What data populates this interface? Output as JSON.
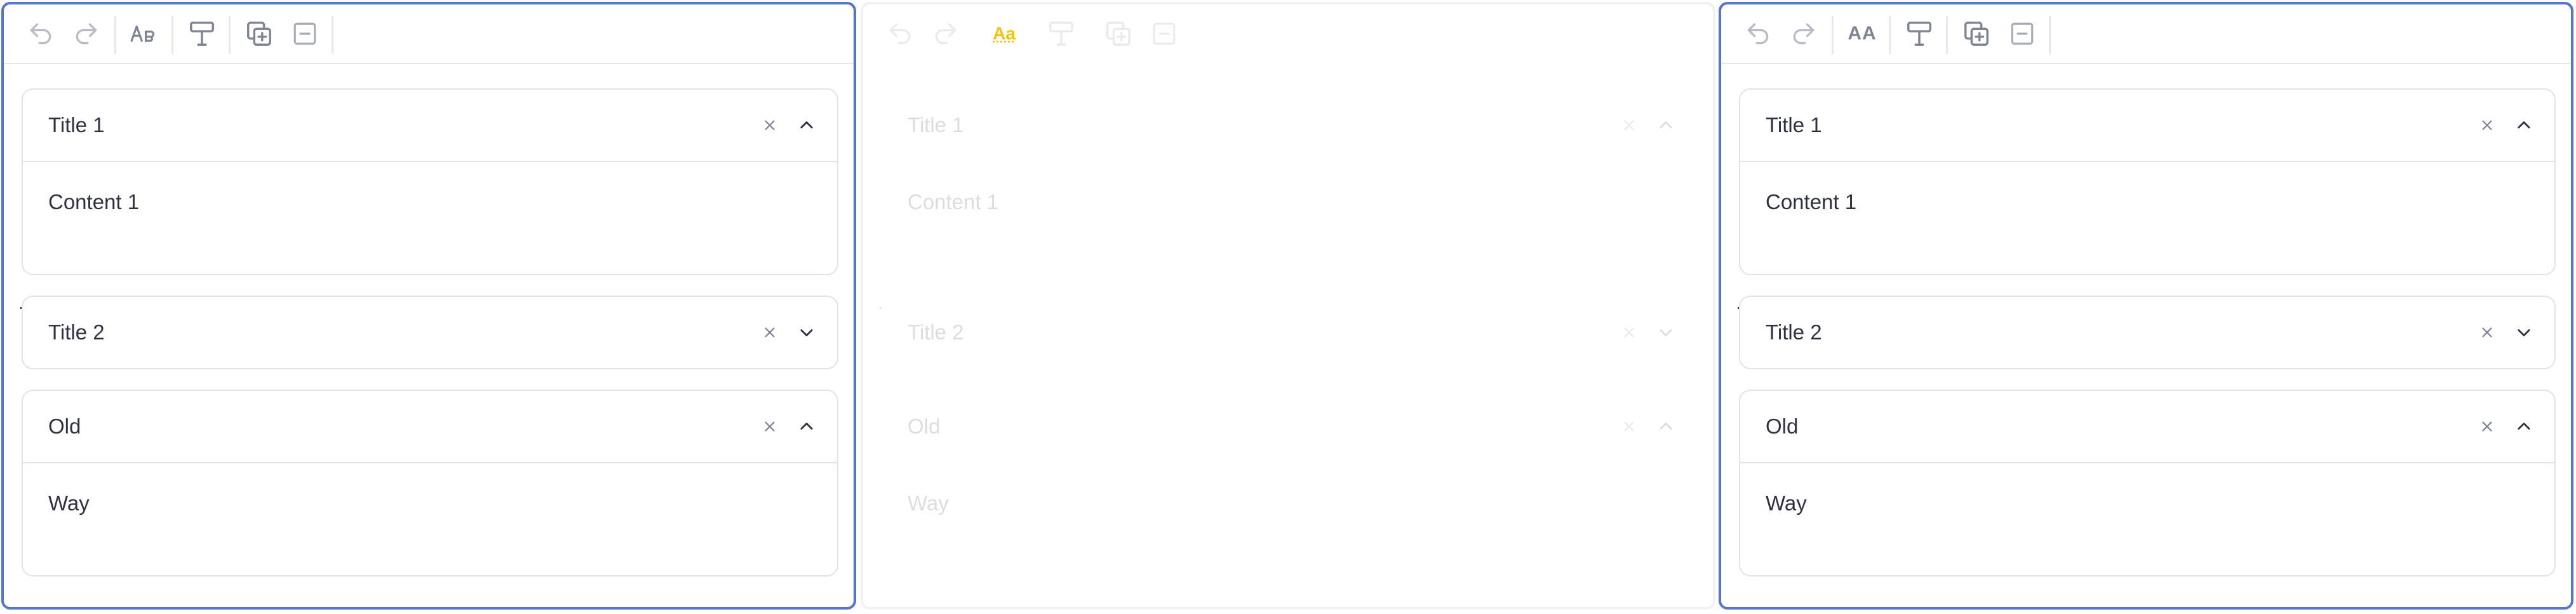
{
  "panels": [
    {
      "id": "left",
      "state": "selected",
      "toolbar": {
        "buttons": [
          "undo-icon",
          "redo-icon",
          "text-size-icon",
          "text-format-icon",
          "add-section-icon",
          "remove-section-icon"
        ]
      },
      "sections": [
        {
          "title": "Title 1",
          "content": "Content 1",
          "expanded": true
        },
        {
          "title": "Title 2",
          "content": "",
          "expanded": false
        },
        {
          "title": "Old",
          "content": "Way",
          "expanded": true
        }
      ]
    },
    {
      "id": "middle",
      "state": "disabled",
      "toolbar": {
        "text_size_label": "Aa",
        "buttons": [
          "undo-icon",
          "redo-icon",
          "text-size-icon",
          "text-format-icon",
          "add-section-icon",
          "remove-section-icon"
        ]
      },
      "sections": [
        {
          "title": "Title 1",
          "content": "Content 1",
          "expanded": true
        },
        {
          "title": "Title 2",
          "content": "",
          "expanded": false
        },
        {
          "title": "Old",
          "content": "Way",
          "expanded": true
        }
      ]
    },
    {
      "id": "right",
      "state": "selected",
      "toolbar": {
        "text_size_label": "AA",
        "buttons": [
          "undo-icon",
          "redo-icon",
          "text-size-icon",
          "text-format-icon",
          "add-section-icon",
          "remove-section-icon"
        ]
      },
      "sections": [
        {
          "title": "Title 1",
          "content": "Content 1",
          "expanded": true
        },
        {
          "title": "Title 2",
          "content": "",
          "expanded": false
        },
        {
          "title": "Old",
          "content": "Way",
          "expanded": true
        }
      ]
    }
  ],
  "colors": {
    "selected_border": "#5474d0",
    "disabled_border": "#f1f2f4",
    "text": "#2f3140",
    "icon": "#7f8494",
    "highlight": "#f2c409"
  }
}
